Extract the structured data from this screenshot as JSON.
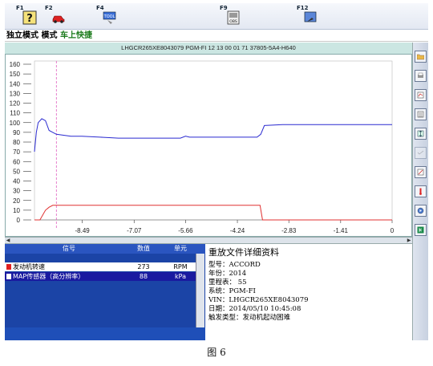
{
  "toolbar": {
    "keys": [
      {
        "key": "F1",
        "icon": "help-icon"
      },
      {
        "key": "F2",
        "icon": "car-icon"
      },
      {
        "key": "F4",
        "icon": "tool-icon"
      },
      {
        "key": "F9",
        "icon": "obd-icon",
        "caption": "OBS"
      },
      {
        "key": "F12",
        "icon": "exit-icon"
      }
    ]
  },
  "mode": {
    "prefix": "独立模式 模式",
    "highlight": " 车上快捷"
  },
  "vin_header": "LHGCR265XE8043079  PGM-FI  12 13 00 01 71  37805-5A4-H640",
  "chart_data": {
    "type": "line",
    "y_ticks": [
      0,
      10,
      20,
      30,
      40,
      50,
      60,
      70,
      80,
      90,
      100,
      110,
      120,
      130,
      140,
      150,
      160
    ],
    "x_ticks": [
      "-8.49",
      "-7.07",
      "-5.66",
      "-4.24",
      "-2.83",
      "-1.41",
      "0"
    ],
    "ylim": [
      0,
      160
    ],
    "xlim": [
      -9.8,
      0
    ],
    "marker_x": -9.2,
    "series": [
      {
        "name": "发动机转速",
        "color": "#2a2ad0",
        "x": [
          -9.8,
          -9.75,
          -9.7,
          -9.6,
          -9.5,
          -9.4,
          -9.3,
          -9.2,
          -9.0,
          -8.8,
          -8.5,
          -8.0,
          -7.5,
          -7.0,
          -6.5,
          -6.0,
          -5.8,
          -5.66,
          -5.55,
          -5.4,
          -5.0,
          -4.5,
          -4.0,
          -3.7,
          -3.6,
          -3.5,
          -3.0,
          -2.0,
          -1.0,
          0
        ],
        "values": [
          70,
          90,
          100,
          104,
          102,
          92,
          90,
          88,
          87,
          86,
          86,
          85,
          84,
          84,
          84,
          84,
          84,
          86,
          85,
          85,
          85,
          85,
          85,
          85,
          88,
          97,
          98,
          98,
          98,
          98
        ]
      },
      {
        "name": "MAP传感器（高分辨率）",
        "color": "#e03030",
        "x": [
          -9.8,
          -9.65,
          -9.5,
          -9.4,
          -9.3,
          -9.0,
          -8.0,
          -7.0,
          -6.0,
          -5.0,
          -4.0,
          -3.8,
          -3.62,
          -3.55,
          -3.0,
          -2.0,
          -1.0,
          0
        ],
        "values": [
          0,
          0,
          10,
          13,
          15,
          15,
          15,
          15,
          15,
          15,
          15,
          15,
          15,
          0,
          0,
          0,
          0,
          0
        ]
      }
    ]
  },
  "table": {
    "headers": [
      "信号",
      "数值",
      "单元"
    ],
    "rows": [
      {
        "name": "发动机转速",
        "value": "273",
        "unit": "RPM",
        "swatch": "#e02020"
      },
      {
        "name": "MAP传感器（高分辨率）",
        "value": "88",
        "unit": "kPa",
        "swatch": "#1a1aa0"
      }
    ]
  },
  "detail": {
    "title": "重放文件详细资料",
    "lines": [
      "型号：ACCORD",
      "年份：2014",
      "里程表： 55",
      "系统：PGM-FI",
      "VIN：LHGCR265XE8043079",
      "日期：2014/05/10  10:45:08",
      "触发类型：发动机起动困难"
    ]
  },
  "right_toolbar": [
    "open-icon",
    "print-icon",
    "chart-settings-icon",
    "list-icon",
    "zoom-fit-icon",
    "disabled-icon",
    "edit-icon",
    "trigger-icon",
    "replay-icon",
    "exit-icon"
  ],
  "caption": "图 6"
}
